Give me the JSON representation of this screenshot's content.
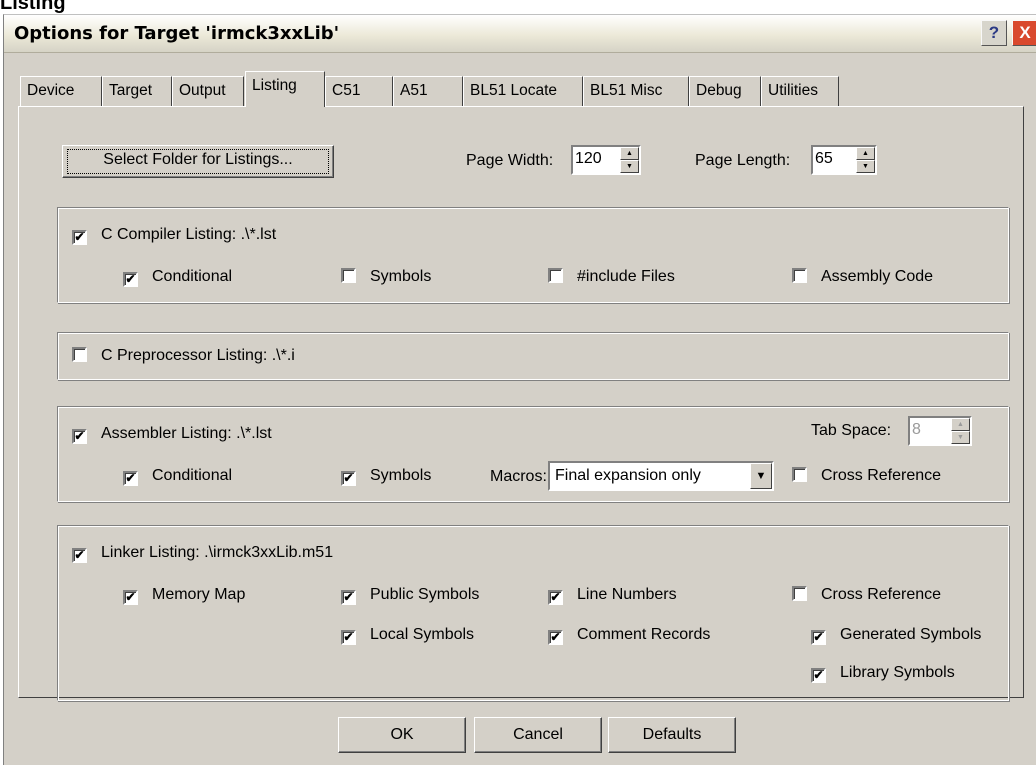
{
  "heading": "Listing",
  "window": {
    "title": "Options for Target 'irmck3xxLib'",
    "help": "?",
    "close": "X"
  },
  "tabs": [
    "Device",
    "Target",
    "Output",
    "Listing",
    "C51",
    "A51",
    "BL51 Locate",
    "BL51 Misc",
    "Debug",
    "Utilities"
  ],
  "active_tab": "Listing",
  "top": {
    "select_folder": "Select Folder for Listings...",
    "page_width_label": "Page Width:",
    "page_width_value": "120",
    "page_length_label": "Page Length:",
    "page_length_value": "65"
  },
  "c_compiler": {
    "label": "C Compiler Listing:  .\\*.lst",
    "checked": true,
    "options": [
      {
        "label": "Conditional",
        "checked": true
      },
      {
        "label": "Symbols",
        "checked": false
      },
      {
        "label": "#include Files",
        "checked": false
      },
      {
        "label": "Assembly Code",
        "checked": false
      }
    ]
  },
  "c_preprocessor": {
    "label": "C Preprocessor Listing:  .\\*.i",
    "checked": false
  },
  "assembler": {
    "label": "Assembler Listing:  .\\*.lst",
    "checked": true,
    "tab_space_label": "Tab Space:",
    "tab_space_value": "8",
    "conditional": {
      "label": "Conditional",
      "checked": true
    },
    "symbols": {
      "label": "Symbols",
      "checked": true
    },
    "macros_label": "Macros:",
    "macros_value": "Final expansion only",
    "cross_reference": {
      "label": "Cross Reference",
      "checked": false
    }
  },
  "linker": {
    "label": "Linker Listing:  .\\irmck3xxLib.m51",
    "checked": true,
    "options": [
      {
        "label": "Memory Map",
        "checked": true
      },
      {
        "label": "Public Symbols",
        "checked": true
      },
      {
        "label": "Line Numbers",
        "checked": true
      },
      {
        "label": "Cross Reference",
        "checked": false
      },
      {
        "label": "Local Symbols",
        "checked": true
      },
      {
        "label": "Comment Records",
        "checked": true
      },
      {
        "label": "Generated Symbols",
        "checked": true
      },
      {
        "label": "Library Symbols",
        "checked": true
      }
    ]
  },
  "buttons": {
    "ok": "OK",
    "cancel": "Cancel",
    "defaults": "Defaults"
  },
  "check_mark": "✔"
}
